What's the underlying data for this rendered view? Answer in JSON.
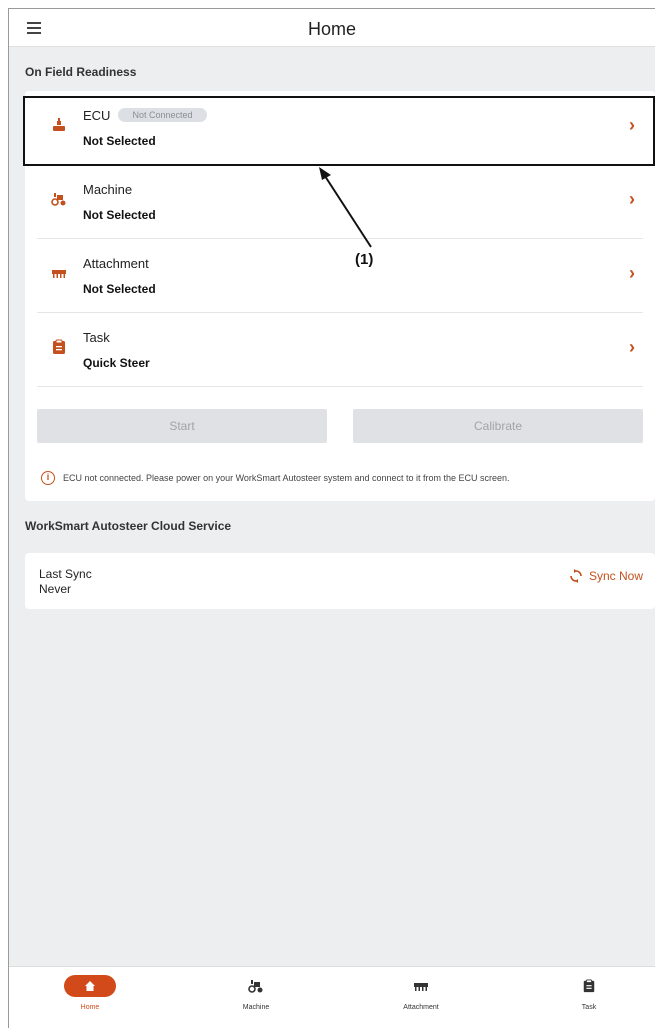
{
  "header": {
    "title": "Home"
  },
  "readiness": {
    "section_title": "On Field Readiness",
    "items": [
      {
        "label": "ECU",
        "badge": "Not Connected",
        "value": "Not Selected",
        "icon": "ecu-icon"
      },
      {
        "label": "Machine",
        "value": "Not Selected",
        "icon": "tractor-icon"
      },
      {
        "label": "Attachment",
        "value": "Not Selected",
        "icon": "attachment-icon"
      },
      {
        "label": "Task",
        "value": "Quick Steer",
        "icon": "clipboard-icon"
      }
    ],
    "start_label": "Start",
    "calibrate_label": "Calibrate",
    "info_message": "ECU not connected. Please power on your WorkSmart Autosteer system and connect to it from the ECU screen."
  },
  "annotation": "(1)",
  "cloud": {
    "section_title": "WorkSmart Autosteer Cloud Service",
    "last_sync_label": "Last Sync",
    "last_sync_value": "Never",
    "sync_now_label": "Sync Now"
  },
  "bottom_nav": [
    {
      "label": "Home",
      "icon": "home-icon",
      "active": true
    },
    {
      "label": "Machine",
      "icon": "tractor-icon",
      "active": false
    },
    {
      "label": "Attachment",
      "icon": "attachment-icon",
      "active": false
    },
    {
      "label": "Task",
      "icon": "clipboard-icon",
      "active": false
    }
  ],
  "colors": {
    "accent": "#c4501e",
    "nav_active": "#d24a1a",
    "background": "#eceef0"
  }
}
